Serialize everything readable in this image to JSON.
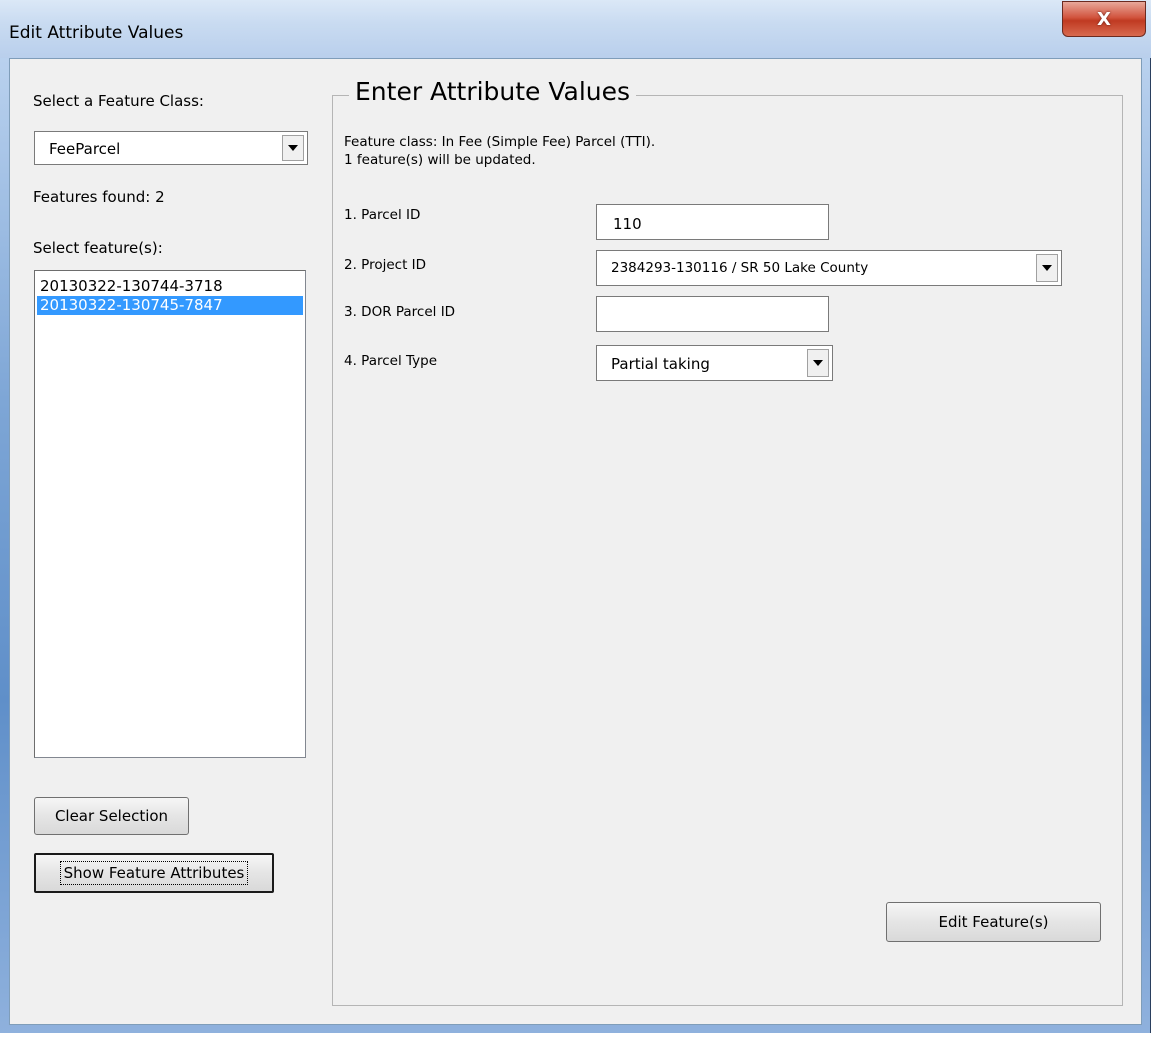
{
  "window": {
    "title": "Edit Attribute Values",
    "close_glyph": "X"
  },
  "left": {
    "feature_class_label": "Select a Feature Class:",
    "feature_class_value": "FeeParcel",
    "features_found": "Features found: 2",
    "select_features_label": "Select feature(s):",
    "features": [
      {
        "id": "20130322-130744-3718",
        "selected": false
      },
      {
        "id": "20130322-130745-7847",
        "selected": true
      }
    ],
    "clear_button": "Clear Selection",
    "show_button": "Show Feature Attributes"
  },
  "group": {
    "title": "Enter Attribute Values",
    "info_line1": "Feature class: In Fee (Simple Fee) Parcel (TTI).",
    "info_line2": "1 feature(s) will be updated.",
    "fields": [
      {
        "label": "1. Parcel ID",
        "value": "110"
      },
      {
        "label": "2. Project ID",
        "value": "2384293-130116 / SR 50 Lake County"
      },
      {
        "label": "3. DOR Parcel ID",
        "value": ""
      },
      {
        "label": "4. Parcel Type",
        "value": "Partial taking"
      }
    ],
    "edit_button": "Edit Feature(s)"
  },
  "colors": {
    "selection": "#3399ff",
    "title_bar": "#c9dbf1",
    "close_button": "#c03a22"
  },
  "icons": {
    "dropdown": "chevron-down-icon",
    "close": "close-icon"
  }
}
